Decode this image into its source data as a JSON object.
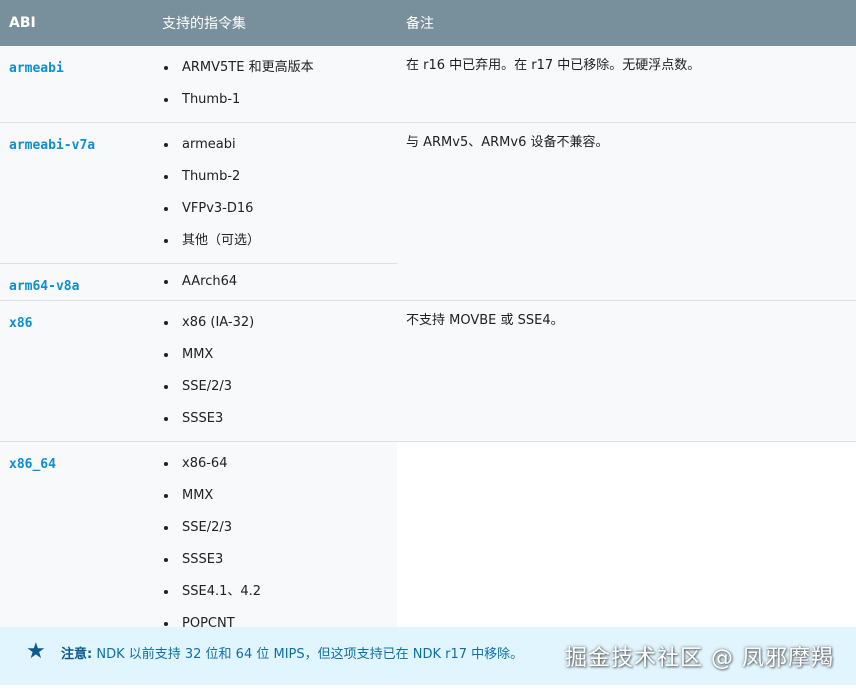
{
  "table": {
    "headers": [
      "ABI",
      "支持的指令集",
      "备注"
    ],
    "rows": [
      {
        "abi": "armeabi",
        "instructions": [
          "ARMV5TE 和更高版本",
          "Thumb-1"
        ],
        "note": "在 r16 中已弃用。在 r17 中已移除。无硬浮点数。"
      },
      {
        "abi": "armeabi-v7a",
        "instructions": [
          "armeabi",
          "Thumb-2",
          "VFPv3-D16",
          "其他（可选）"
        ],
        "note": "与 ARMv5、ARMv6 设备不兼容。"
      },
      {
        "abi": "arm64-v8a",
        "instructions": [
          "AArch64"
        ],
        "note": ""
      },
      {
        "abi": "x86",
        "instructions": [
          "x86 (IA-32)",
          "MMX",
          "SSE/2/3",
          "SSSE3"
        ],
        "note": "不支持 MOVBE 或 SSE4。"
      },
      {
        "abi": "x86_64",
        "instructions": [
          "x86-64",
          "MMX",
          "SSE/2/3",
          "SSSE3",
          "SSE4.1、4.2",
          "POPCNT"
        ],
        "note": ""
      }
    ]
  },
  "notice": {
    "icon": "star-icon",
    "label": "注意:",
    "text": "NDK 以前支持 32 位和 64 位 MIPS，但这项支持已在 NDK r17 中移除。"
  },
  "watermark": "掘金技术社区 @ 凤邪摩羯",
  "colors": {
    "header_bg": "#78909c",
    "abi_name": "#0d8ed4",
    "notice_bg": "#e1f5fe",
    "notice_text": "#0d6fa8",
    "row_bg": "#f7f9fa"
  }
}
